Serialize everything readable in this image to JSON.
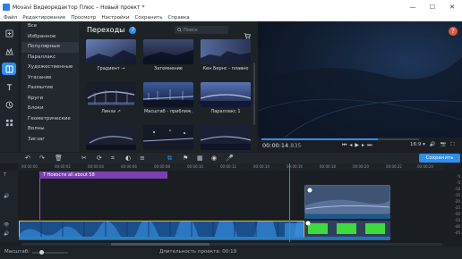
{
  "window": {
    "title": "Movavi Видеоредактор Плюс – Новый проект *",
    "controls": {
      "minimize": "—",
      "maximize": "☐",
      "close": "✕"
    }
  },
  "menu": [
    "Файл",
    "Редактирование",
    "Просмотр",
    "Настройки",
    "Сохранить",
    "Справка"
  ],
  "rail": [
    "import-icon",
    "filters-icon",
    "transitions-icon",
    "titles-icon",
    "stickers-icon",
    "more-tools-icon"
  ],
  "categories": [
    "Все",
    "Избранное",
    "Популярные",
    "Параллакс",
    "Художественные",
    "Угасание",
    "Размытие",
    "Круги",
    "Блоки",
    "Геометрические",
    "Волны",
    "Зигзаг"
  ],
  "active_category": "Популярные",
  "panel": {
    "title": "Переходы",
    "search_placeholder": "Поиск",
    "tiles": [
      {
        "label": "Градиент →"
      },
      {
        "label": "Затемнение"
      },
      {
        "label": "Кен Бернс - плавно"
      },
      {
        "label": "Линза ↗"
      },
      {
        "label": "Масштаб - приближ."
      },
      {
        "label": "Параллакс 1"
      },
      {
        "label": ""
      },
      {
        "label": ""
      },
      {
        "label": ""
      }
    ]
  },
  "preview": {
    "help": "?",
    "time_main": "00:00:14",
    "time_ms": ".835",
    "progress": 0.74,
    "aspect": "16:9 ▾"
  },
  "toolbar": {
    "export_label": "Сохранить"
  },
  "ruler": [
    "00:00:00",
    "00:00:02",
    "00:00:04",
    "00:00:06",
    "00:00:08",
    "00:00:10",
    "00:00:12",
    "00:00:14",
    "00:00:16",
    "00:00:18",
    "00:00:20",
    "00:00:22",
    "00:00:24"
  ],
  "timeline": {
    "title_clip": "Новости all about 58",
    "track_icons": [
      "T",
      "🔊",
      "👁",
      "🔊"
    ]
  },
  "volume_scale": [
    "0",
    "-5",
    "-10",
    "-15",
    "-20",
    "-25",
    "-30",
    "-35",
    "-40",
    "-45",
    "-50"
  ],
  "status": {
    "scale_label": "Масштаб:",
    "duration_label": "Длительность проекта:",
    "duration_value": "00:19"
  },
  "colors": {
    "accent": "#2d8ff0",
    "title_clip": "#7b3fb3",
    "playhead": "#e74a3b",
    "green_screen": "#3ddc3d"
  }
}
